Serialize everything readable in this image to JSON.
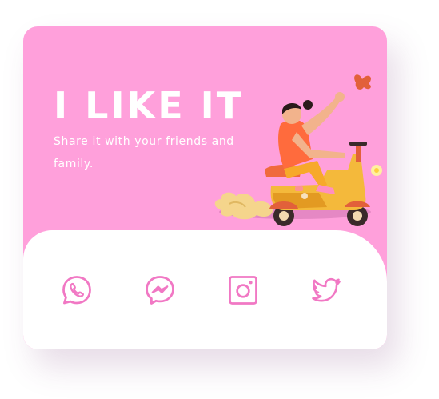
{
  "hero": {
    "title": "I LIKE IT",
    "subtitle": "Share it with your friends and family."
  },
  "share": {
    "items": [
      {
        "icon": "whatsapp-icon"
      },
      {
        "icon": "messenger-icon"
      },
      {
        "icon": "instagram-icon"
      },
      {
        "icon": "twitter-icon"
      }
    ]
  },
  "colors": {
    "card_background": "#ffa0db",
    "icon_color": "#f178c4",
    "panel_background": "#ffffff"
  }
}
